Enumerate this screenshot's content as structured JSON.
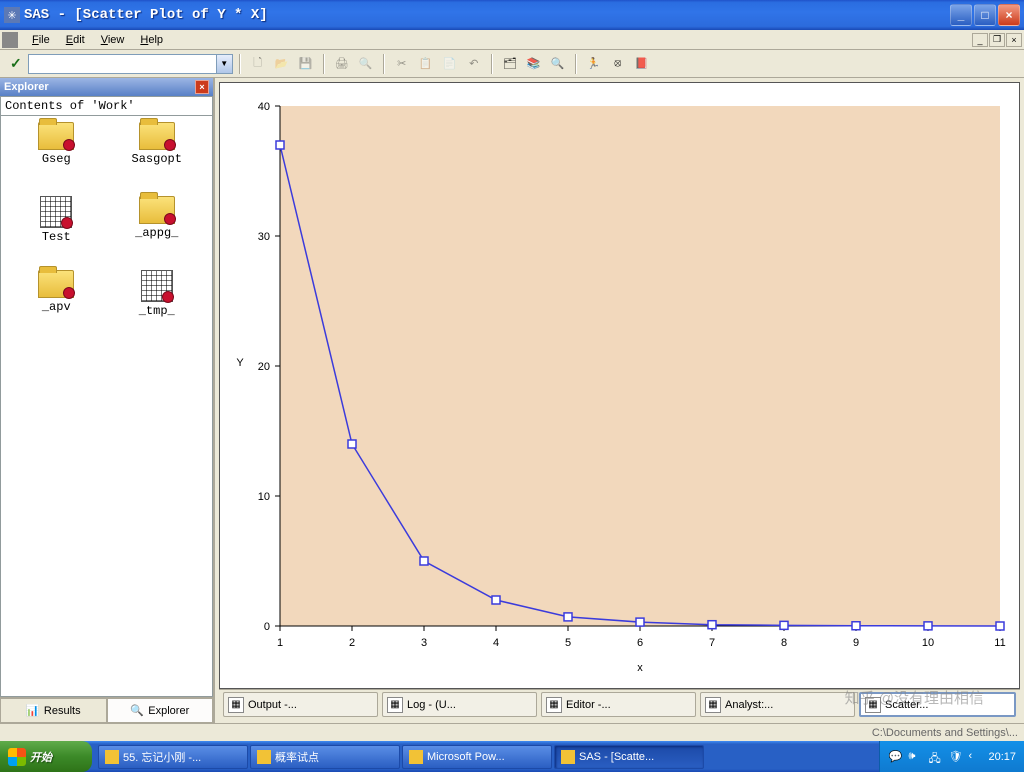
{
  "window": {
    "title": "SAS - [Scatter Plot of Y * X]"
  },
  "menus": {
    "file": "File",
    "edit": "Edit",
    "view": "View",
    "help": "Help"
  },
  "explorer": {
    "title": "Explorer",
    "contents": "Contents of 'Work'",
    "items": [
      {
        "name": "Gseg",
        "type": "folder"
      },
      {
        "name": "Sasgopt",
        "type": "folder"
      },
      {
        "name": "Test",
        "type": "grid"
      },
      {
        "name": "_appg_",
        "type": "folder"
      },
      {
        "name": "_apv",
        "type": "folder"
      },
      {
        "name": "_tmp_",
        "type": "grid"
      }
    ],
    "tabs": {
      "results": "Results",
      "explorer": "Explorer"
    }
  },
  "window_tabs": [
    {
      "label": "Output -..."
    },
    {
      "label": "Log - (U..."
    },
    {
      "label": "Editor -..."
    },
    {
      "label": "Analyst:..."
    },
    {
      "label": "Scatter...",
      "active": true
    }
  ],
  "statusbar": {
    "path": "C:\\Documents and Settings\\..."
  },
  "taskbar": {
    "start": "开始",
    "buttons": [
      {
        "label": "55. 忘记小刚 -..."
      },
      {
        "label": "概率试点"
      },
      {
        "label": "Microsoft Pow..."
      },
      {
        "label": "SAS - [Scatte...",
        "active": true
      }
    ],
    "clock": "20:17"
  },
  "watermark": "知乎 @没有理由相信",
  "chart_data": {
    "type": "line",
    "x": [
      1,
      2,
      3,
      4,
      5,
      6,
      7,
      8,
      9,
      10,
      11
    ],
    "y": [
      37,
      14,
      5,
      2,
      0.7,
      0.3,
      0.1,
      0.05,
      0.02,
      0.01,
      0
    ],
    "xlabel": "x",
    "ylabel": "Y",
    "xlim": [
      1,
      11
    ],
    "ylim": [
      0,
      40
    ],
    "xticks": [
      1,
      2,
      3,
      4,
      5,
      6,
      7,
      8,
      9,
      10,
      11
    ],
    "yticks": [
      0,
      10,
      20,
      30,
      40
    ],
    "marker": "square",
    "line_color": "#3b3bdc",
    "plot_bg": "#f2d8bc"
  }
}
